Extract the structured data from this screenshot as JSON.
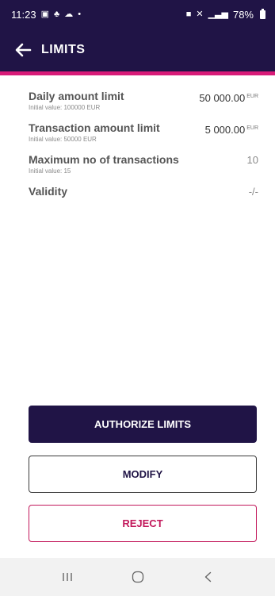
{
  "status_bar": {
    "time": "11:23",
    "battery": "78%"
  },
  "app_bar": {
    "title": "LIMITS"
  },
  "limits": [
    {
      "label": "Daily amount limit",
      "sub": "Initial value: 100000 EUR",
      "value": "50 000.00",
      "currency": "EUR"
    },
    {
      "label": "Transaction amount limit",
      "sub": "Initial value: 50000 EUR",
      "value": "5 000.00",
      "currency": "EUR"
    },
    {
      "label": "Maximum no of transactions",
      "sub": "Initial value: 15",
      "value": "10",
      "currency": ""
    },
    {
      "label": "Validity",
      "sub": "",
      "value": "-/-",
      "currency": ""
    }
  ],
  "buttons": {
    "authorize": "AUTHORIZE LIMITS",
    "modify": "MODIFY",
    "reject": "REJECT"
  },
  "colors": {
    "primary": "#201446",
    "accent": "#d81b78",
    "reject": "#c2185b"
  }
}
